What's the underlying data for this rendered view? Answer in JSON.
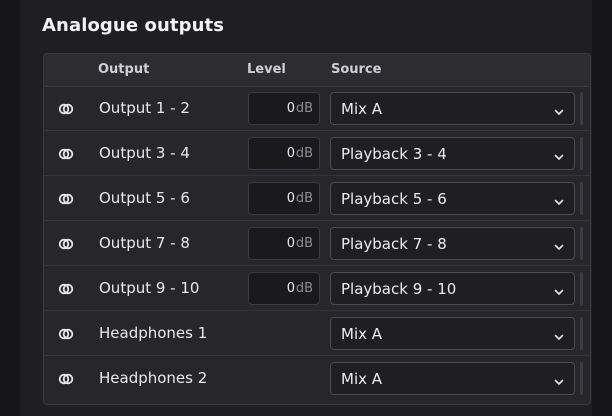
{
  "section": {
    "title": "Analogue outputs"
  },
  "columns": {
    "output": "Output",
    "level": "Level",
    "source": "Source"
  },
  "rows": [
    {
      "output": "Output 1 - 2",
      "level": "0",
      "unit": "dB",
      "source": "Mix A"
    },
    {
      "output": "Output 3 - 4",
      "level": "0",
      "unit": "dB",
      "source": "Playback 3 - 4"
    },
    {
      "output": "Output 5 - 6",
      "level": "0",
      "unit": "dB",
      "source": "Playback 5 - 6"
    },
    {
      "output": "Output 7 - 8",
      "level": "0",
      "unit": "dB",
      "source": "Playback 7 - 8"
    },
    {
      "output": "Output 9 - 10",
      "level": "0",
      "unit": "dB",
      "source": "Playback 9 - 10"
    },
    {
      "output": "Headphones 1",
      "source": "Mix A"
    },
    {
      "output": "Headphones 2",
      "source": "Mix A"
    }
  ],
  "icons": {
    "link": "stereo-link-icon",
    "chevron": "chevron-down-icon"
  },
  "colors": {
    "background": "#1f1f22",
    "table": "#27272b",
    "text": "#e9e9ee"
  }
}
